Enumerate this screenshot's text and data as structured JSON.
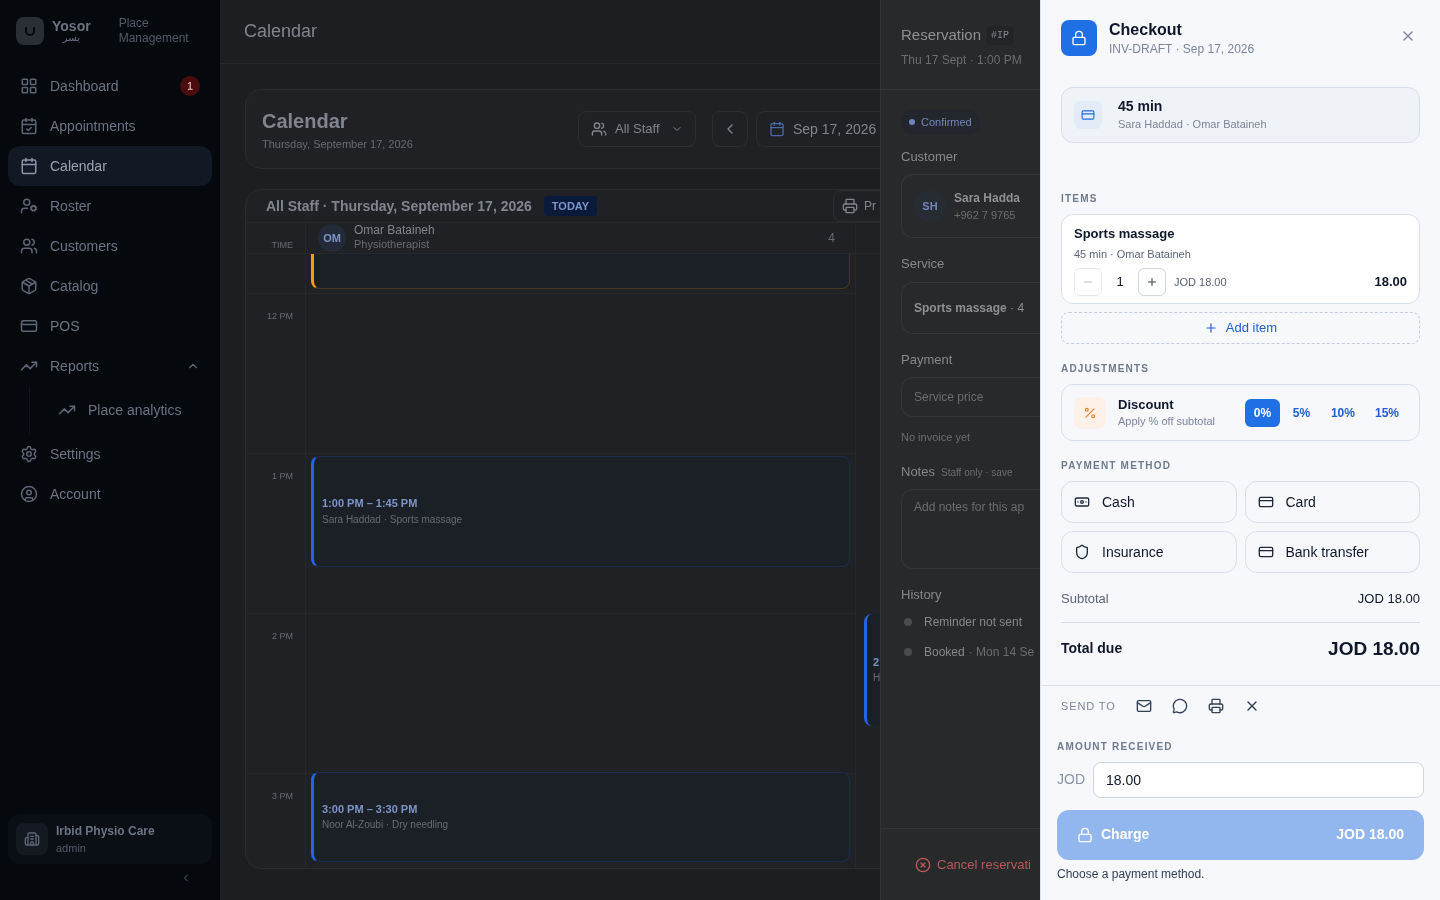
{
  "sidebar": {
    "brand": {
      "name": "Yosor",
      "name_arabic": "يسر",
      "subtitle": "Place Management"
    },
    "items": [
      {
        "label": "Dashboard",
        "badge": "1",
        "selected": false
      },
      {
        "label": "Appointments",
        "selected": false
      },
      {
        "label": "Calendar",
        "selected": true
      },
      {
        "label": "Roster",
        "selected": false
      },
      {
        "label": "Customers",
        "selected": false
      },
      {
        "label": "Catalog",
        "selected": false
      },
      {
        "label": "POS",
        "selected": false
      },
      {
        "label": "Reports",
        "selected": false,
        "expanded": true,
        "children": [
          {
            "label": "Place analytics",
            "selected": false
          }
        ]
      },
      {
        "label": "Settings",
        "selected": false
      },
      {
        "label": "Account",
        "selected": false
      }
    ],
    "workspace": {
      "name": "Irbid Physio Care",
      "role": "admin"
    }
  },
  "topbar": {
    "title": "Calendar"
  },
  "calendar_header": {
    "title": "Calendar",
    "date": "Thursday, September 17, 2026",
    "staff_filter": "All Staff",
    "date_picker": "Sep 17, 2026"
  },
  "schedule": {
    "heading": "All Staff · Thursday, September 17, 2026",
    "badge": "TODAY",
    "print_button": "Pr",
    "time_heading": "TIME",
    "staff": [
      {
        "initials": "OM",
        "name": "Omar Bataineh",
        "role": "Physiotherapist",
        "count": "4"
      }
    ],
    "hours": [
      "12 PM",
      "1 PM",
      "2 PM",
      "3 PM"
    ],
    "events": [
      {
        "kind": "cut",
        "color": "#f59e0b"
      },
      {
        "kind": "full",
        "time": "1:00 PM – 1:45 PM",
        "detail": "Sara Haddad · Sports massage",
        "color": "#2563eb"
      },
      {
        "kind": "full",
        "time": "3:00 PM – 3:30 PM",
        "detail": "Noor Al-Zoubi · Dry needling",
        "color": "#2563eb"
      }
    ],
    "next_column_events": [
      {
        "time": "2",
        "detail": "H"
      }
    ]
  },
  "reservation": {
    "title": "Reservation",
    "tag": "#IP",
    "subtitle": "Thu 17 Sept · 1:00 PM",
    "status": "Confirmed",
    "customer_label": "Customer",
    "customer": {
      "initials": "SH",
      "name": "Sara Hadda",
      "phone": "+962 7 9765"
    },
    "service_label": "Service",
    "service": "**Sports massage** · 4",
    "payment_label": "Payment",
    "payment_row": "Service price",
    "payment_note": "No invoice yet",
    "notes_label": "Notes",
    "notes_hint": "Staff only · save",
    "notes_placeholder": "Add notes for this ap",
    "history_label": "History",
    "history": [
      {
        "label": "Reminder not sent"
      },
      {
        "label": "Booked",
        "date": "· Mon 14 Se"
      }
    ],
    "cancel_button": "Cancel reservati"
  },
  "checkout": {
    "title": "Checkout",
    "subtitle": "INV-DRAFT · Sep 17, 2026",
    "summary": {
      "title": "45 min",
      "detail": "Sara Haddad · Omar Bataineh"
    },
    "items_label": "ITEMS",
    "items": [
      {
        "name": "Sports massage",
        "detail": "45 min · Omar Bataineh",
        "quantity": "1",
        "unit_price": "JOD 18.00",
        "total": "18.00"
      }
    ],
    "add_item": "Add item",
    "adjustments_label": "ADJUSTMENTS",
    "discount": {
      "title": "Discount",
      "detail": "Apply % off subtotal",
      "options": [
        {
          "label": "0%",
          "selected": true
        },
        {
          "label": "5%",
          "selected": false
        },
        {
          "label": "10%",
          "selected": false
        },
        {
          "label": "15%",
          "selected": false
        }
      ]
    },
    "payment_label": "PAYMENT METHOD",
    "payment_methods": [
      {
        "label": "Cash",
        "selected": false
      },
      {
        "label": "Card",
        "selected": false
      },
      {
        "label": "Insurance",
        "selected": false
      },
      {
        "label": "Bank transfer",
        "selected": false
      }
    ],
    "subtotal_label": "Subtotal",
    "subtotal": "JOD 18.00",
    "total_label": "Total due",
    "total": "JOD 18.00",
    "send_to_label": "SEND TO",
    "amount_label": "AMOUNT RECEIVED",
    "currency": "JOD",
    "amount": "18.00",
    "charge": {
      "label": "Charge",
      "amount": "JOD 18.00",
      "disabled": true
    },
    "hint": "Choose a payment method."
  }
}
